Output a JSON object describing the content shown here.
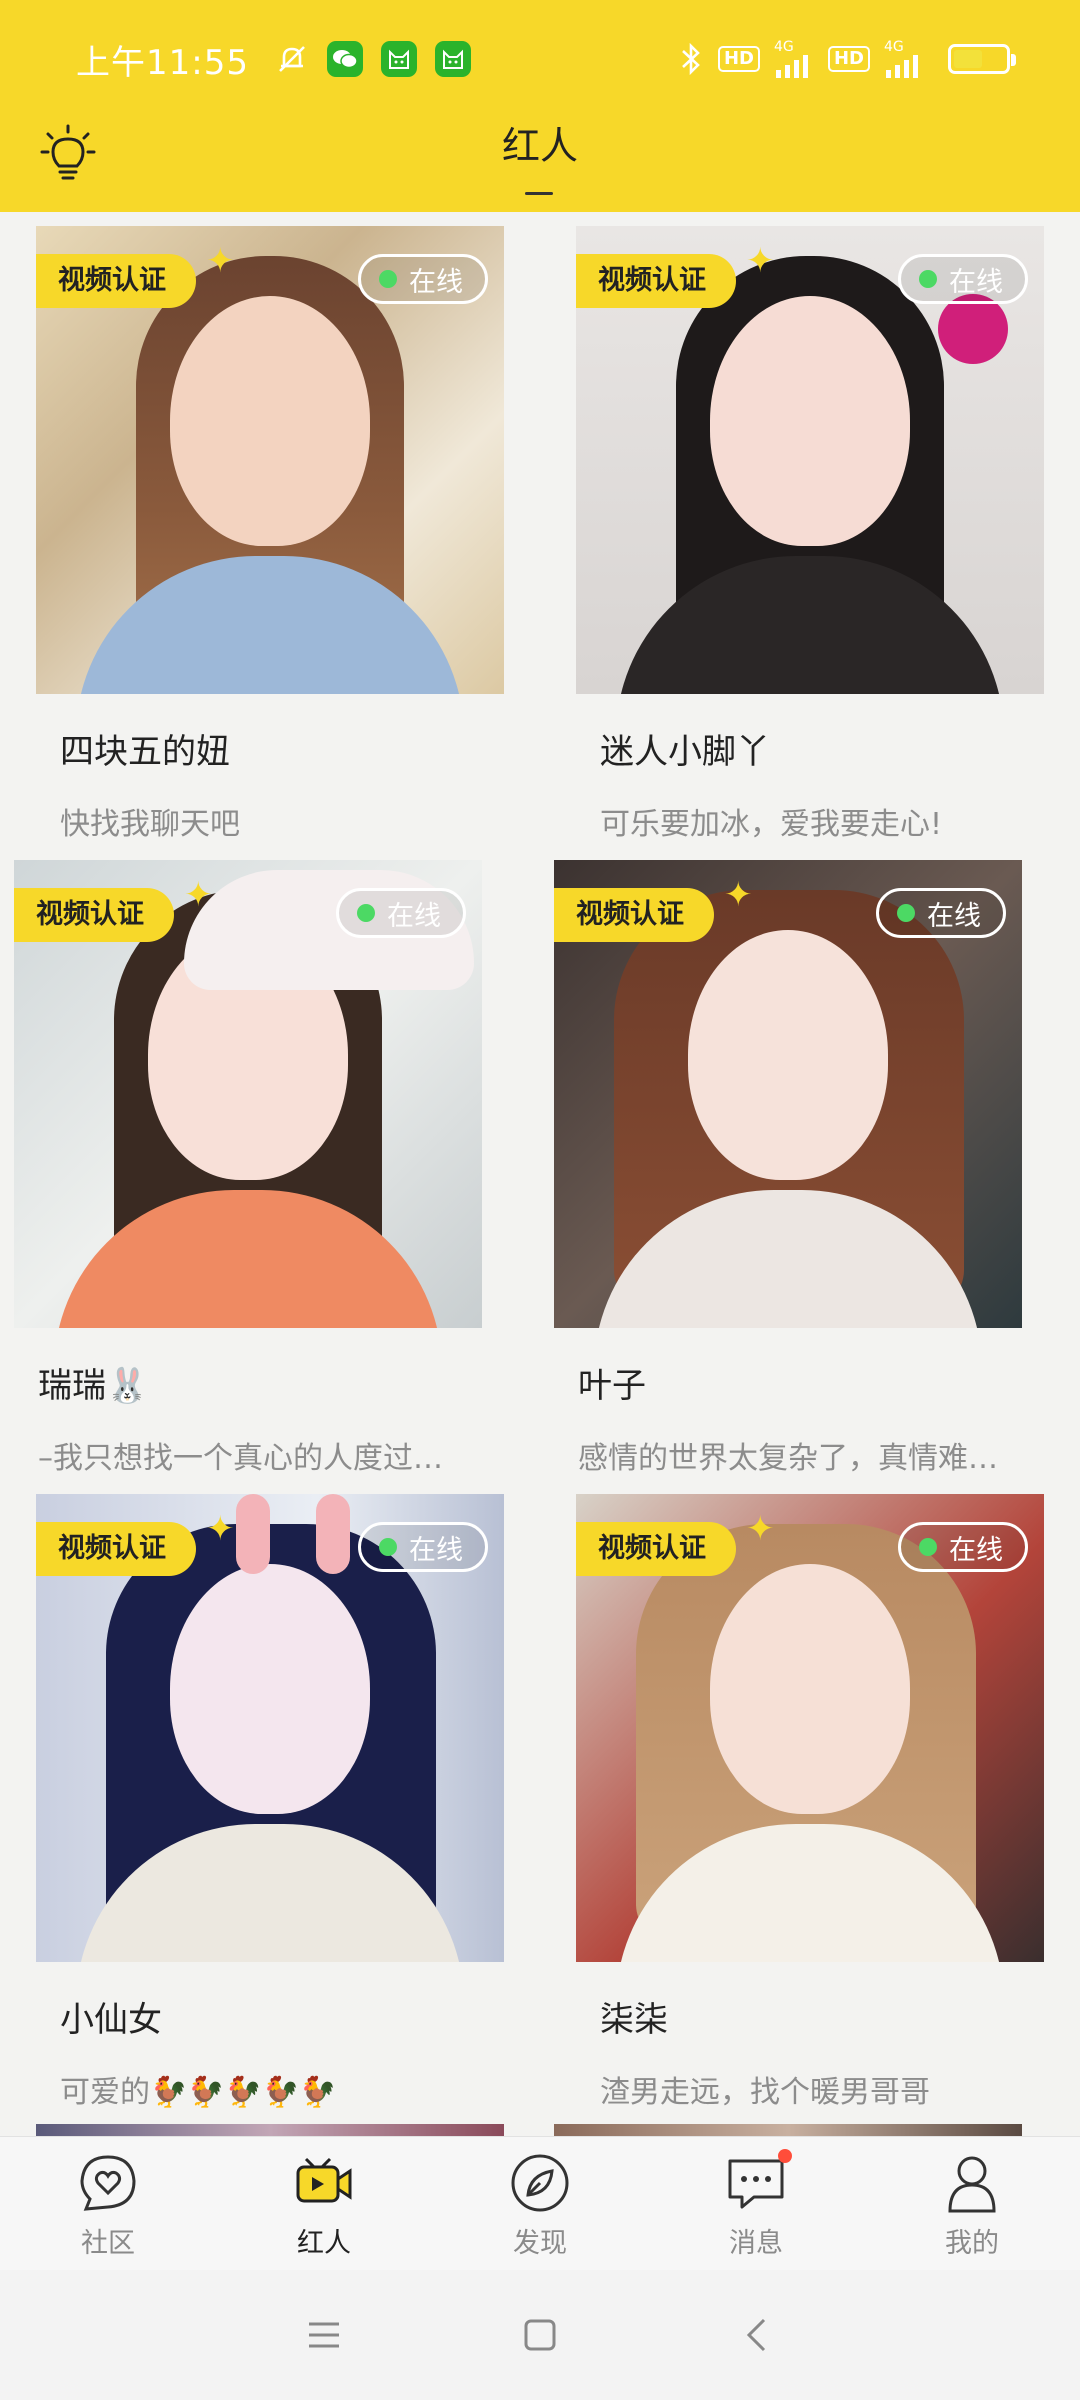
{
  "status_bar": {
    "time": "上午11:55",
    "network_1": "4G",
    "network_2": "4G",
    "hd_1": "HD",
    "hd_2": "HD",
    "icons": [
      "bell-off-icon",
      "wechat-icon",
      "app-cat-icon",
      "app-cat-icon",
      "bluetooth-icon",
      "signal-icon",
      "battery-charging-icon"
    ]
  },
  "header": {
    "title": "红人",
    "left_icon": "lightbulb-icon"
  },
  "cards": [
    {
      "verify_label": "视频认证",
      "status": "在线",
      "name": "四块五的妞",
      "bio": "快找我聊天吧"
    },
    {
      "verify_label": "视频认证",
      "status": "在线",
      "name": "迷人小脚丫",
      "bio": "可乐要加冰，爱我要走心!"
    },
    {
      "verify_label": "视频认证",
      "status": "在线",
      "name": "瑞瑞🐰",
      "bio": "–我只想找一个真心的人度过…"
    },
    {
      "verify_label": "视频认证",
      "status": "在线",
      "name": "叶子",
      "bio": "感情的世界太复杂了，真情难…"
    },
    {
      "verify_label": "视频认证",
      "status": "在线",
      "name": "小仙女",
      "bio": "可爱的🐓🐓🐓🐓🐓"
    },
    {
      "verify_label": "视频认证",
      "status": "在线",
      "name": "柒柒",
      "bio": "渣男走远，找个暖男哥哥"
    }
  ],
  "bottom_nav": [
    {
      "label": "社区",
      "icon": "chat-heart-icon",
      "active": false
    },
    {
      "label": "红人",
      "icon": "video-camera-icon",
      "active": true
    },
    {
      "label": "发现",
      "icon": "compass-leaf-icon",
      "active": false
    },
    {
      "label": "消息",
      "icon": "message-icon",
      "active": false,
      "badge": true
    },
    {
      "label": "我的",
      "icon": "person-icon",
      "active": false
    }
  ],
  "system_nav": [
    "menu-icon",
    "home-icon",
    "back-icon"
  ],
  "colors": {
    "brand_yellow": "#f7d829",
    "online_green": "#4cd964",
    "badge_red": "#ff4d3a"
  }
}
